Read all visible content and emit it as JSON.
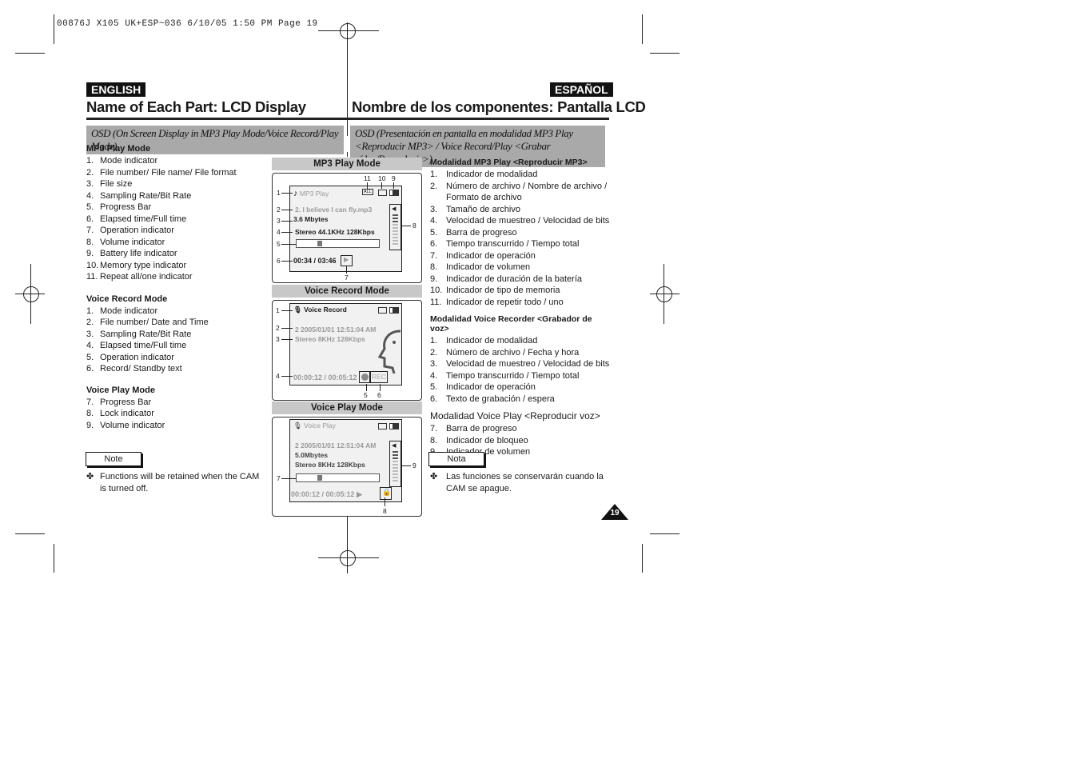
{
  "print_header": "00876J X105 UK+ESP~036   6/10/05 1:50 PM   Page 19",
  "english": {
    "language_tag": "ENGLISH",
    "title": "Name of Each Part: LCD Display",
    "osd_heading": "OSD (On Screen Display in MP3 Play Mode/Voice Record/Play Mode)",
    "sections": [
      {
        "heading": "MP3 Play Mode",
        "items": [
          {
            "n": "1.",
            "text": "Mode indicator"
          },
          {
            "n": "2.",
            "text": "File number/ File name/ File format"
          },
          {
            "n": "3.",
            "text": "File size"
          },
          {
            "n": "4.",
            "text": "Sampling Rate/Bit Rate"
          },
          {
            "n": "5.",
            "text": "Progress Bar"
          },
          {
            "n": "6.",
            "text": "Elapsed time/Full time"
          },
          {
            "n": "7.",
            "text": "Operation indicator"
          },
          {
            "n": "8.",
            "text": "Volume indicator"
          },
          {
            "n": "9.",
            "text": "Battery life indicator"
          },
          {
            "n": "10.",
            "text": "Memory type indicator"
          },
          {
            "n": "11.",
            "text": "Repeat all/one indicator"
          }
        ]
      },
      {
        "heading": "Voice Record Mode",
        "items": [
          {
            "n": "1.",
            "text": "Mode indicator"
          },
          {
            "n": "2.",
            "text": "File number/ Date and Time"
          },
          {
            "n": "3.",
            "text": "Sampling Rate/Bit Rate"
          },
          {
            "n": "4.",
            "text": "Elapsed time/Full time"
          },
          {
            "n": "5.",
            "text": "Operation indicator"
          },
          {
            "n": "6.",
            "text": "Record/ Standby text"
          }
        ]
      },
      {
        "heading": "Voice Play Mode",
        "items": [
          {
            "n": "7.",
            "text": "Progress Bar"
          },
          {
            "n": "8.",
            "text": "Lock indicator"
          },
          {
            "n": "9.",
            "text": "Volume indicator"
          }
        ]
      }
    ],
    "note_label": "Note",
    "note_bullet": "✤",
    "note_text": "Functions will be retained when the CAM is turned off."
  },
  "espanol": {
    "language_tag": "ESPAÑOL",
    "title": "Nombre de los componentes: Pantalla LCD",
    "osd_heading": "OSD (Presentación en pantalla en modalidad MP3 Play <Reproducir MP3> / Voice Record/Play <Grabar vídeo/Reproducir>)",
    "sections": [
      {
        "heading": "Modalidad MP3 Play <Reproducir MP3>",
        "items": [
          {
            "n": "1.",
            "text": "Indicador de modalidad"
          },
          {
            "n": "2.",
            "text": "Número de archivo / Nombre de archivo  / Formato de archivo"
          },
          {
            "n": "3.",
            "text": "Tamaño de archivo"
          },
          {
            "n": "4.",
            "text": "Velocidad de muestreo / Velocidad de bits"
          },
          {
            "n": "5.",
            "text": "Barra de progreso"
          },
          {
            "n": "6.",
            "text": "Tiempo transcurrido / Tiempo total"
          },
          {
            "n": "7.",
            "text": "Indicador de operación"
          },
          {
            "n": "8.",
            "text": "Indicador de volumen"
          },
          {
            "n": "9.",
            "text": "Indicador de duración de la batería"
          },
          {
            "n": "10.",
            "text": "Indicador de tipo de memoria"
          },
          {
            "n": "11.",
            "text": "Indicador de repetir todo / uno"
          }
        ]
      },
      {
        "heading": "Modalidad Voice Recorder <Grabador de voz>",
        "items": [
          {
            "n": "1.",
            "text": "Indicador de modalidad"
          },
          {
            "n": "2.",
            "text": "Número de archivo / Fecha y hora"
          },
          {
            "n": "3.",
            "text": "Velocidad de muestreo / Velocidad de bits"
          },
          {
            "n": "4.",
            "text": "Tiempo transcurrido / Tiempo total"
          },
          {
            "n": "5.",
            "text": "Indicador de operación"
          },
          {
            "n": "6.",
            "text": "Texto de grabación / espera"
          }
        ]
      },
      {
        "heading": "Modalidad Voice Play <Reproducir voz>",
        "items": [
          {
            "n": "7.",
            "text": "Barra de progreso"
          },
          {
            "n": "8.",
            "text": "Indicador de bloqueo"
          },
          {
            "n": "9.",
            "text": "Indicador de volumen"
          }
        ]
      }
    ],
    "note_label": "Nota",
    "note_bullet": "✤",
    "note_text": "Las funciones se conservarán cuando la CAM se apague."
  },
  "diagrams": {
    "mp3": {
      "header": "MP3 Play Mode",
      "mode_label": "MP3 Play",
      "file": "2.  I believe I can fly.mp3",
      "size": "3.6 Mbytes",
      "rate": "Stereo 44.1KHz 128Kbps",
      "time": "00:34 / 03:46",
      "repeat_badge": "ALL",
      "progress": 0.27,
      "volume_level": 3,
      "volume_max": 10,
      "callouts": [
        "1",
        "2",
        "3",
        "4",
        "5",
        "6",
        "7",
        "8",
        "9",
        "10",
        "11"
      ]
    },
    "voice_record": {
      "header": "Voice Record Mode",
      "mode_label": "Voice Record",
      "file": "2  2005/01/01  12:51:04 AM",
      "rate": "Stereo  8KHz  128Kbps",
      "time": "00:00:12 / 00:05:12",
      "rec_text": "REC",
      "callouts": [
        "1",
        "2",
        "3",
        "4",
        "5",
        "6"
      ]
    },
    "voice_play": {
      "header": "Voice Play Mode",
      "mode_label": "Voice Play",
      "file": "2  2005/01/01  12:51:04 AM",
      "size": "5.0Mbytes",
      "rate": "Stereo  8KHz  128Kbps",
      "time": "00:00:12 / 00:05:12",
      "progress": 0.27,
      "volume_level": 3,
      "volume_max": 10,
      "callouts": [
        "7",
        "8",
        "9"
      ]
    }
  },
  "page_number": "19"
}
